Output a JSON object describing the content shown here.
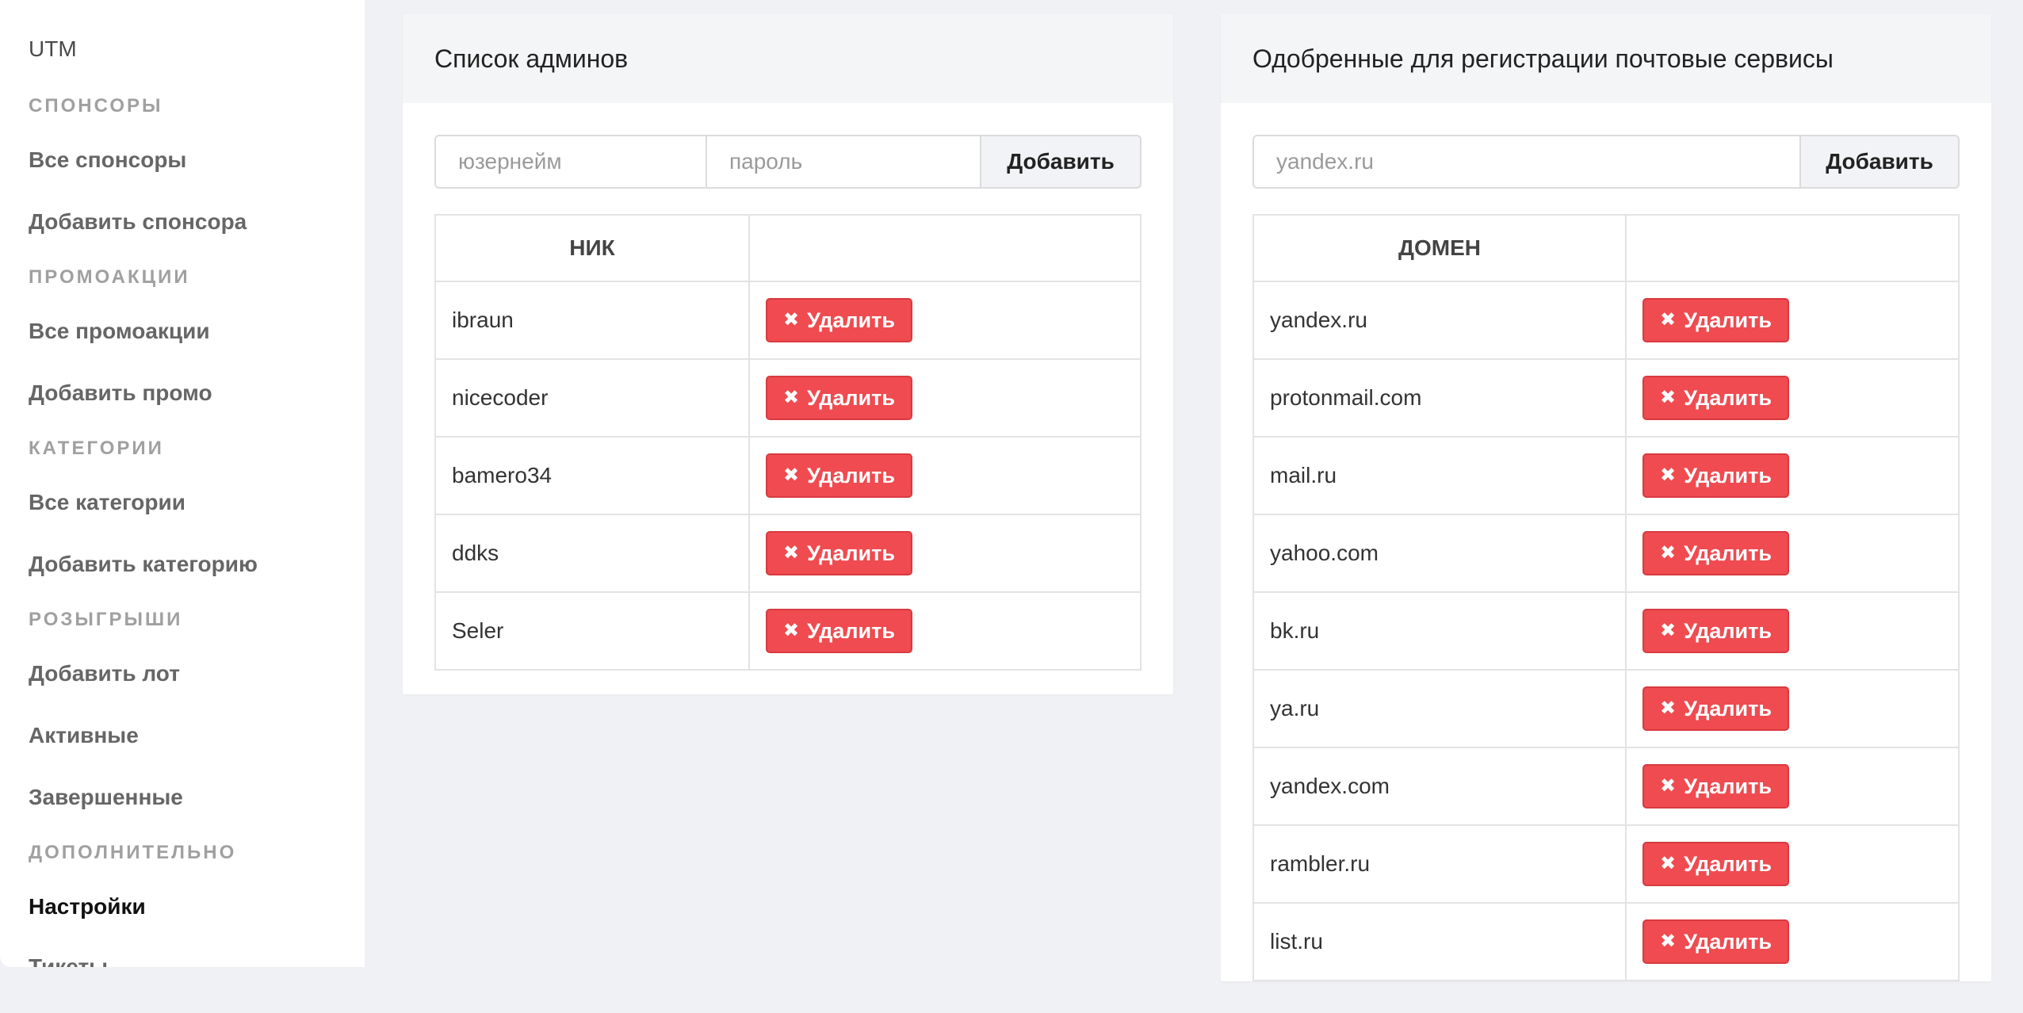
{
  "sidebar": {
    "top_link": "UTM",
    "sections": [
      {
        "label": "СПОНСОРЫ",
        "items": [
          "Все спонсоры",
          "Добавить спонсора"
        ]
      },
      {
        "label": "ПРОМОАКЦИИ",
        "items": [
          "Все промоакции",
          "Добавить промо"
        ]
      },
      {
        "label": "КАТЕГОРИИ",
        "items": [
          "Все категории",
          "Добавить категорию"
        ]
      },
      {
        "label": "РОЗЫГРЫШИ",
        "items": [
          "Добавить лот",
          "Активные",
          "Завершенные"
        ]
      },
      {
        "label": "ДОПОЛНИТЕЛЬНО",
        "items": [
          "Настройки",
          "Тикеты"
        ]
      }
    ],
    "active_item": "Настройки"
  },
  "admins": {
    "title": "Список админов",
    "username_placeholder": "юзернейм",
    "password_placeholder": "пароль",
    "add_label": "Добавить",
    "col_nick": "НИК",
    "col_actions": "",
    "rows": [
      "ibraun",
      "nicecoder",
      "bamero34",
      "ddks",
      "Seler"
    ],
    "delete_label": "Удалить"
  },
  "domains": {
    "title": "Одобренные для регистрации почтовые сервисы",
    "input_placeholder": "yandex.ru",
    "add_label": "Добавить",
    "col_domain": "ДОМЕН",
    "col_actions": "",
    "rows": [
      "yandex.ru",
      "protonmail.com",
      "mail.ru",
      "yahoo.com",
      "bk.ru",
      "ya.ru",
      "yandex.com",
      "rambler.ru",
      "list.ru"
    ],
    "delete_label": "Удалить"
  },
  "colors": {
    "delete_button": "#ef4b50",
    "background": "#f0f1f5",
    "card_header": "#f4f5f7"
  },
  "icons": {
    "delete": "times-icon"
  }
}
